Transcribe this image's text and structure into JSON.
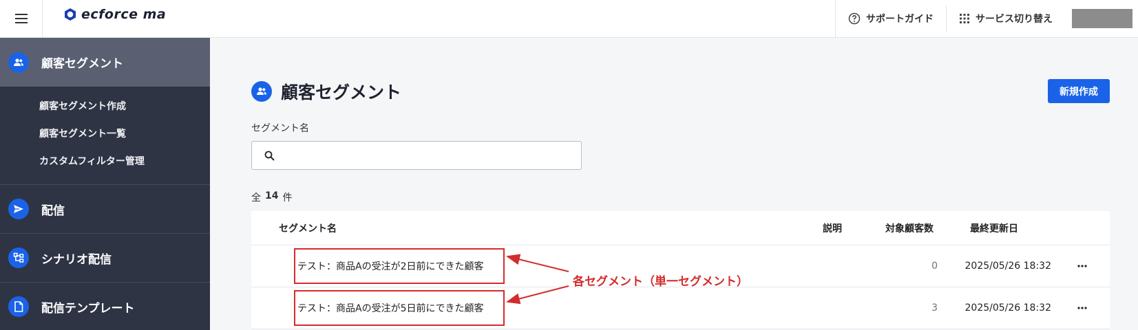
{
  "header": {
    "logo_text": "ecforce ma",
    "support_label": "サポートガイド",
    "service_switch_label": "サービス切り替え"
  },
  "sidebar": {
    "items": [
      {
        "label": "顧客セグメント",
        "icon": "users-icon"
      },
      {
        "label": "配信",
        "icon": "send-icon"
      },
      {
        "label": "シナリオ配信",
        "icon": "flow-icon"
      },
      {
        "label": "配信テンプレート",
        "icon": "document-icon"
      }
    ],
    "sub_items": [
      "顧客セグメント作成",
      "顧客セグメント一覧",
      "カスタムフィルター管理"
    ]
  },
  "main": {
    "title": "顧客セグメント",
    "new_button": "新規作成",
    "search_label": "セグメント名",
    "search_value": "",
    "count_prefix": "全",
    "count_value": "14",
    "count_suffix": "件",
    "table": {
      "columns": [
        "セグメント名",
        "説明",
        "対象顧客数",
        "最終更新日"
      ],
      "rows": [
        {
          "name": "テスト：商品Aの受注が2日前にできた顧客",
          "description": "",
          "customers": "0",
          "updated": "2025/05/26 18:32"
        },
        {
          "name": "テスト：商品Aの受注が5日前にできた顧客",
          "description": "",
          "customers": "3",
          "updated": "2025/05/26 18:32"
        }
      ]
    }
  },
  "annotation": {
    "text": "各セグメント（単一セグメント）",
    "color": "#d42c2c"
  },
  "colors": {
    "accent": "#1a63e8",
    "sidebar_bg": "#2f3445",
    "sidebar_active": "#5a6072"
  }
}
